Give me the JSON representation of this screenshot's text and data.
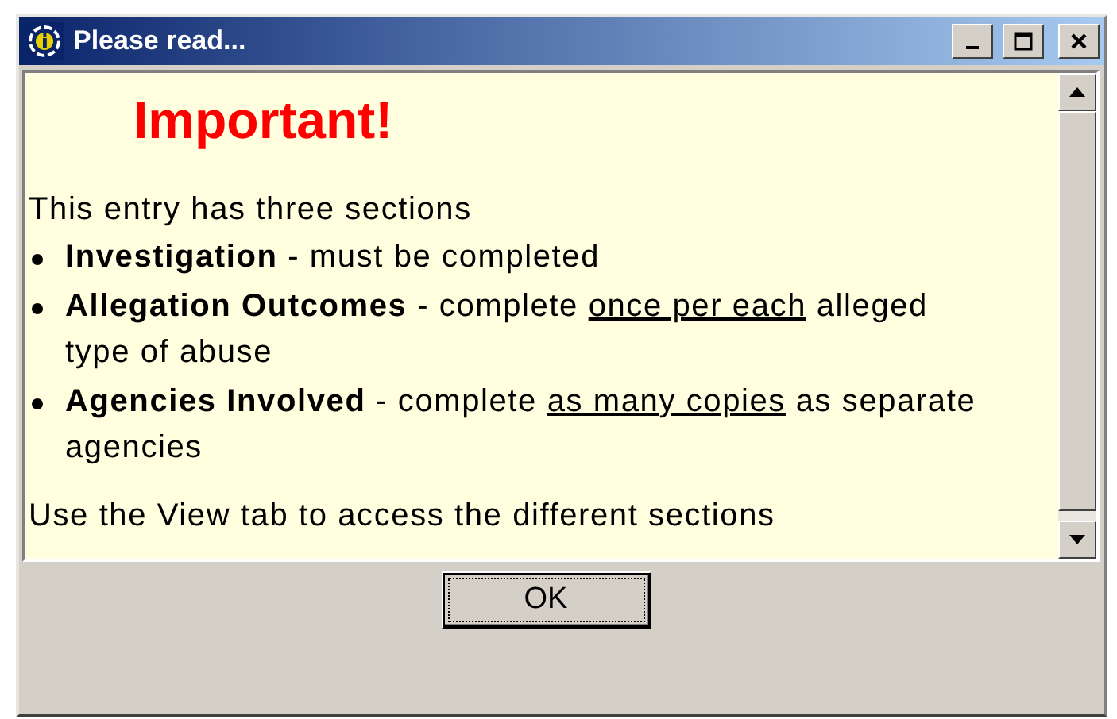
{
  "window": {
    "title": "Please read..."
  },
  "heading": "Important!",
  "intro": "This entry has three sections",
  "items": [
    {
      "segments": [
        {
          "kind": "bold",
          "text": "Investigation"
        },
        {
          "kind": "plain",
          "text": " - must be completed"
        }
      ]
    },
    {
      "segments": [
        {
          "kind": "bold",
          "text": "Allegation Outcomes"
        },
        {
          "kind": "plain",
          "text": " - complete "
        },
        {
          "kind": "underline",
          "text": "once per each"
        },
        {
          "kind": "plain",
          "text": " alleged type of abuse"
        }
      ]
    },
    {
      "segments": [
        {
          "kind": "bold",
          "text": "Agencies Involved"
        },
        {
          "kind": "plain",
          "text": " - complete "
        },
        {
          "kind": "underline",
          "text": "as many copies"
        },
        {
          "kind": "plain",
          "text": " as separate agencies"
        }
      ]
    }
  ],
  "footer": "Use the View tab to access the different sections",
  "buttons": [
    {
      "label": "OK",
      "focused": true
    }
  ]
}
